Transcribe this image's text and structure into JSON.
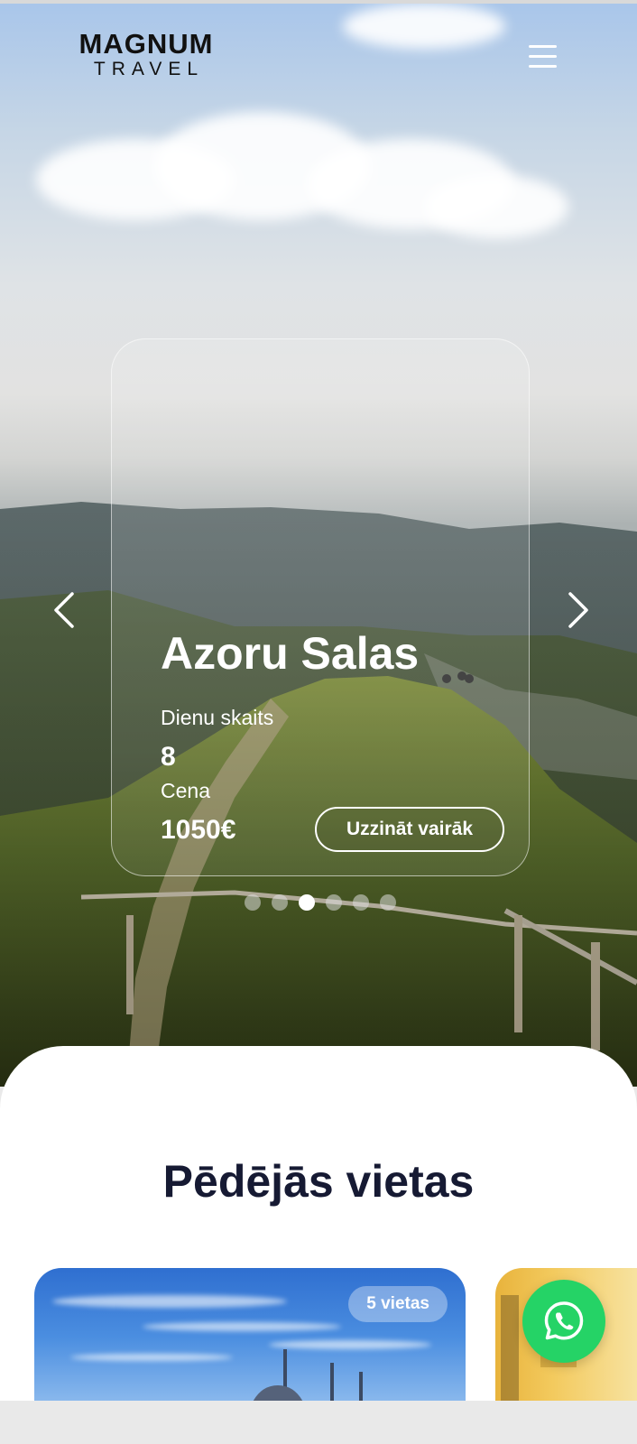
{
  "brand": {
    "logo_top": "MAGNUM",
    "logo_bottom": "TRAVEL"
  },
  "header": {
    "menu_icon": "hamburger-menu-icon"
  },
  "hero_slide": {
    "title": "Azoru Salas",
    "days_label": "Dienu skaits",
    "days_value": "8",
    "price_label": "Cena",
    "price_value": "1050€",
    "cta_label": "Uzzināt vairāk"
  },
  "carousel": {
    "slide_count": 6,
    "active_index": 2,
    "prev_icon": "chevron-left-icon",
    "next_icon": "chevron-right-icon"
  },
  "section": {
    "title": "Pēdējās vietas"
  },
  "destinations": [
    {
      "badge": "5 vietas"
    }
  ],
  "floating": {
    "icon": "whatsapp-icon",
    "color": "#25d366"
  },
  "colors": {
    "heading": "#161a33",
    "accent_text": "#ffffff"
  }
}
